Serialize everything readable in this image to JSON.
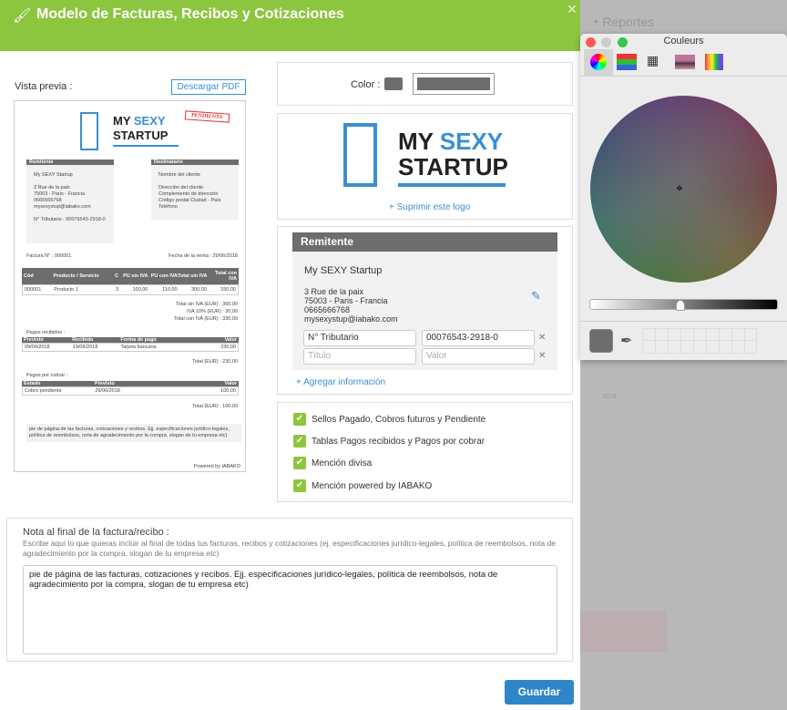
{
  "background": {
    "reports_label": "Reportes",
    "year": "2018"
  },
  "modal": {
    "title": "Modelo de Facturas, Recibos y Cotizaciones",
    "preview_label": "Vista previa :",
    "download_pdf": "Descargar PDF",
    "color_label": "Color :",
    "color_value": "#6d6d6d",
    "accent": "#8cc63e",
    "brand_blue": "#3a8fd0",
    "logo": {
      "line1a": "MY",
      "line1b": "SEXY",
      "line2": "STARTUP",
      "remove": "+ Suprimir este logo"
    },
    "sender": {
      "header": "Remitente",
      "name": "My SEXY Startup",
      "address": [
        "3 Rue de la paix",
        "75003 - Paris - Francia",
        "0665666768",
        "mysexystup@iabako.com"
      ],
      "fields": [
        {
          "title": "N° Tributario",
          "value": "00076543-2918-0"
        },
        {
          "title_placeholder": "Título",
          "value_placeholder": "Valor"
        }
      ],
      "add_info": "+ Agregar información"
    },
    "options": [
      "Sellos Pagado, Cobros futuros y Pendiente",
      "Tablas Pagos recibidos y Pagos por cobrar",
      "Mención divisa",
      "Mención powered by IABAKO"
    ],
    "note": {
      "title": "Nota al final de la factura/recibo :",
      "help": "Escribe aquí lo que quieras incluir al final de todas tus facturas, recibos y cotizaciones (ej. especificaciones jurídico-legales, política de reembolsos, nota de agradecimiento por la compra, slogan de tu empresa etc)",
      "value": "pie de página de las facturas, cotizaciones y recibos. Ejj. especificaciones jurídico-legales, política de reembolsos, nota de agradecimiento por la compra, slogan de tu empresa etc)"
    },
    "save": "Guardar"
  },
  "doc": {
    "stamp": "PENDIENTE",
    "sender_h": "Remitente",
    "recipient_h": "Destinatario",
    "sender": [
      "My SEXY Startup",
      "3 Rue de la paix",
      "75003 - Paris - Francia",
      "0665666768",
      "mysexystup@iabako.com",
      "N° Tributario : 00076543-2918-0"
    ],
    "recipient": [
      "Nombre del cliente",
      "Dirección del cliente",
      "Complemento de dirección",
      "Código postal Ciudad - País",
      "Teléfono"
    ],
    "invoice_no": "Factura N° : 000001",
    "sale_date": "Fecha de la venta : 29/06/2018",
    "items_headers": [
      "Cód",
      "Producto / Servicio",
      "C",
      "PU sin IVA",
      "PU con IVA",
      "Total sin IVA",
      "Total con IVA"
    ],
    "items": [
      [
        "000001",
        "Producto 1",
        "3",
        "100,00",
        "110,00",
        "300,00",
        "330,00"
      ]
    ],
    "totals": [
      "Total sin IVA (EUR) : 300,00",
      "IVA 10% (EUR) : 30,00",
      "Total con IVA (EUR) : 330,00"
    ],
    "received_label": "Pagos recibidos :",
    "received_headers": [
      "Previsto",
      "Recibido",
      "Forma de pago",
      "Valor"
    ],
    "received": [
      [
        "09/06/2018",
        "19/06/2018",
        "Tarjeta bancaria",
        "230,00"
      ]
    ],
    "received_total": "Total (EUR) : 230,00",
    "pending_label": "Pagos por cobrar :",
    "pending_headers": [
      "Estado",
      "Previsto",
      "Valor"
    ],
    "pending": [
      [
        "Cobro pendiente",
        "29/06/2018",
        "100,00"
      ]
    ],
    "pending_total": "Total (EUR) : 100,00",
    "footer": "pie de página de las facturas, cotizaciones y recibos. Ejj. especificaciones jurídico-legales, política de reembolsos, nota de agradecimiento por la compra, slogan de tu empresa etc)",
    "powered": "Powered by IABAKO"
  },
  "color_panel": {
    "title": "Couleurs",
    "tabs": [
      "color-wheel",
      "sliders",
      "palettes",
      "image",
      "crayons"
    ],
    "brightness": 0.45
  }
}
